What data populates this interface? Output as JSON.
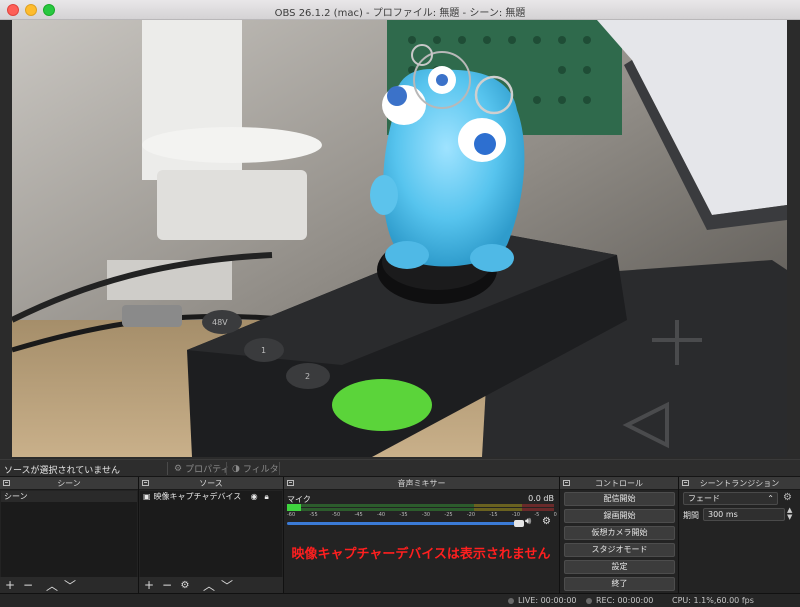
{
  "window": {
    "title": "OBS 26.1.2 (mac) - プロファイル: 無題 - シーン: 無題"
  },
  "source_toolbar": {
    "no_selection": "ソースが選択されていません",
    "properties_label": "プロパティ",
    "filters_label": "フィルタ"
  },
  "scenes_dock": {
    "header": "シーン",
    "items": [
      "シーン"
    ],
    "footer_icons": [
      "add-icon",
      "remove-icon",
      "move-up-icon",
      "move-down-icon"
    ]
  },
  "sources_dock": {
    "header": "ソース",
    "items": [
      {
        "icon": "camera-icon",
        "label": "映像キャプチャデバイス"
      }
    ],
    "footer_icons": [
      "add-icon",
      "remove-icon",
      "gear-icon",
      "move-up-icon",
      "move-down-icon"
    ]
  },
  "mixer_dock": {
    "header": "音声ミキサー",
    "channel_name": "マイク",
    "level": "0.0 dB",
    "meter_ticks": [
      "-60",
      "-55",
      "-50",
      "-45",
      "-40",
      "-35",
      "-30",
      "-25",
      "-20",
      "-15",
      "-10",
      "-5",
      "0"
    ],
    "volume_fraction": 1.0,
    "warning_text": "映像キャプチャーデバイスは表示されません"
  },
  "controls_dock": {
    "header": "コントロール",
    "buttons": [
      "配信開始",
      "録画開始",
      "仮想カメラ開始",
      "スタジオモード",
      "設定",
      "終了"
    ]
  },
  "transitions_dock": {
    "header": "シーントランジション",
    "transition_value": "フェード",
    "duration_label": "期間",
    "duration_value": "300 ms"
  },
  "status_bar": {
    "live": "LIVE: 00:00:00",
    "rec": "REC: 00:00:00",
    "cpu": "CPU: 1.1%,60.00 fps"
  },
  "colors": {
    "warning": "#ff1f1f",
    "slider": "#3b7bd6",
    "meter_green": "#3fd43f"
  }
}
